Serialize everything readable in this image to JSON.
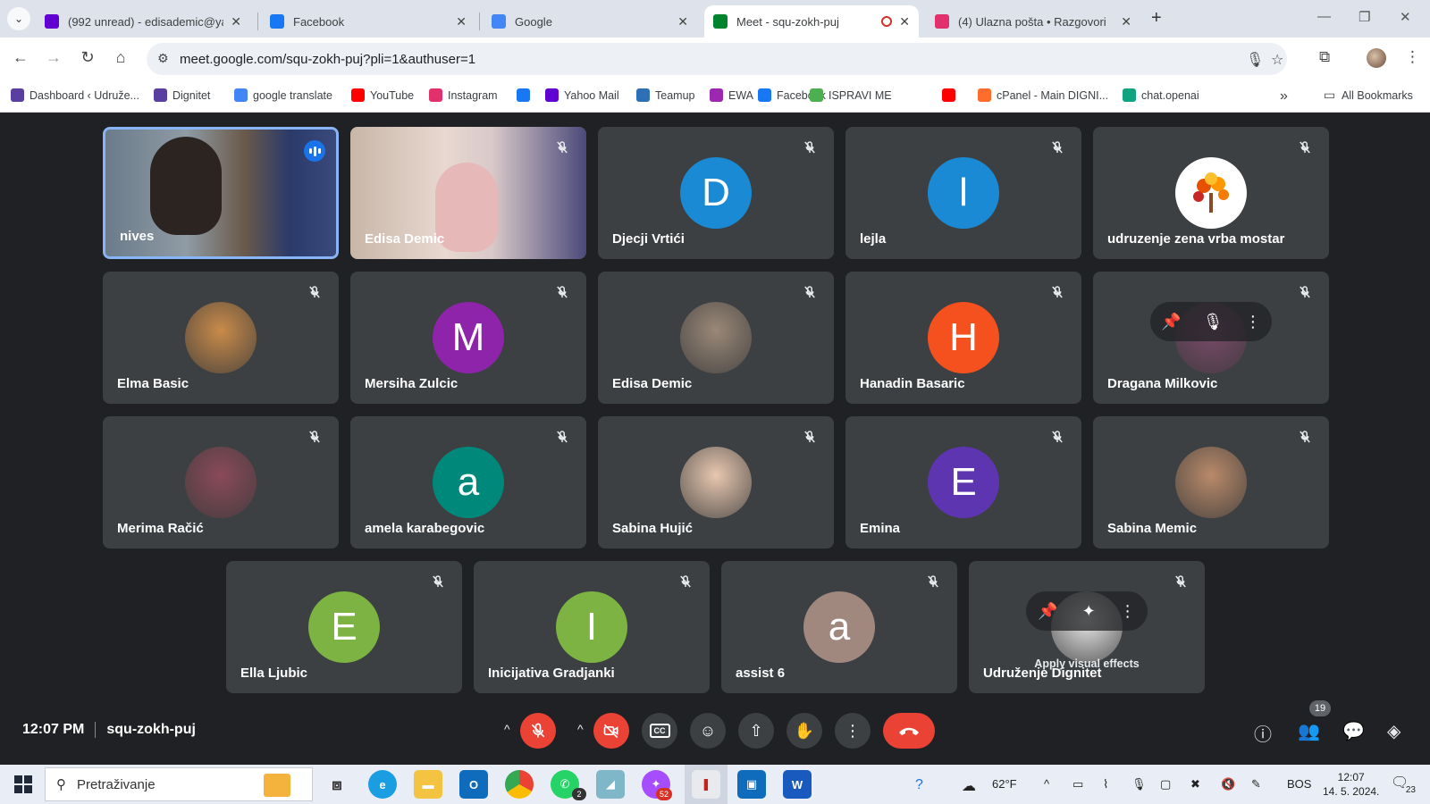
{
  "browser": {
    "tabs": [
      {
        "label": "(992 unread) - edisademic@yah",
        "icon": "yahoo-mail-icon",
        "color": "#6001d2"
      },
      {
        "label": "Facebook",
        "icon": "facebook-icon",
        "color": "#1877f2"
      },
      {
        "label": "Google",
        "icon": "google-icon",
        "color": "#4285f4"
      },
      {
        "label": "Meet - squ-zokh-puj",
        "icon": "meet-icon",
        "color": "#00832d",
        "active": true
      },
      {
        "label": "(4) Ulazna pošta • Razgovori",
        "icon": "instagram-icon",
        "color": "#e1306c"
      }
    ],
    "url": "meet.google.com/squ-zokh-puj?pli=1&authuser=1",
    "bookmarks": [
      {
        "label": "Dashboard ‹ Udruže...",
        "icon": "dashboard-icon",
        "color": "#5b3fa0"
      },
      {
        "label": "Dignitet",
        "icon": "dignitet-icon",
        "color": "#5b3fa0"
      },
      {
        "label": "google translate",
        "icon": "google-icon",
        "color": "#4285f4"
      },
      {
        "label": "YouTube",
        "icon": "youtube-icon",
        "color": "#ff0000"
      },
      {
        "label": "Instagram",
        "icon": "instagram-icon",
        "color": "#e1306c"
      },
      {
        "label": "",
        "icon": "facebook-icon",
        "color": "#1877f2"
      },
      {
        "label": "Yahoo Mail",
        "icon": "yahoo-mail-icon",
        "color": "#6001d2"
      },
      {
        "label": "Teamup",
        "icon": "teamup-icon",
        "color": "#2e6fb7"
      },
      {
        "label": "EWA",
        "icon": "ewa-icon",
        "color": "#9c27b0"
      },
      {
        "label": "Facebook",
        "icon": "facebook-icon",
        "color": "#1877f2"
      },
      {
        "label": "ISPRAVI ME",
        "icon": "check-icon",
        "color": "#4caf50"
      },
      {
        "label": "",
        "icon": "youtube-icon",
        "color": "#ff0000"
      },
      {
        "label": "cPanel - Main DIGNI...",
        "icon": "cpanel-icon",
        "color": "#ff6c2c"
      },
      {
        "label": "chat.openai",
        "icon": "openai-icon",
        "color": "#10a37f"
      }
    ],
    "all_bookmarks": "All Bookmarks"
  },
  "meet": {
    "participants": [
      {
        "name": "nives",
        "type": "video",
        "speaking": true
      },
      {
        "name": "Edisa Demic",
        "type": "video"
      },
      {
        "name": "Djecji Vrtići",
        "type": "letter",
        "letter": "D",
        "color": "#1a8ad4"
      },
      {
        "name": "lejla",
        "type": "letter",
        "letter": "l",
        "color": "#1a8ad4"
      },
      {
        "name": "udruzenje zena vrba mostar",
        "type": "logo"
      },
      {
        "name": "Elma Basic",
        "type": "photo",
        "color": "#c98b4a"
      },
      {
        "name": "Mersiha Zulcic",
        "type": "letter",
        "letter": "M",
        "color": "#8e24aa"
      },
      {
        "name": "Edisa Demic",
        "type": "photo",
        "color": "#9a8878"
      },
      {
        "name": "Hanadin Basaric",
        "type": "letter",
        "letter": "H",
        "color": "#f4511e"
      },
      {
        "name": "Dragana Milkovic",
        "type": "photo-hover",
        "color": "#7a4a6a"
      },
      {
        "name": "Merima Račić",
        "type": "photo",
        "color": "#8a4a5a"
      },
      {
        "name": "amela karabegovic",
        "type": "letter",
        "letter": "a",
        "color": "#00897b"
      },
      {
        "name": "Sabina Hujić",
        "type": "photo",
        "color": "#e8c8b0"
      },
      {
        "name": "Emina",
        "type": "letter",
        "letter": "E",
        "color": "#5e35b1"
      },
      {
        "name": "Sabina Memic",
        "type": "photo",
        "color": "#b98a6a"
      },
      {
        "name": "Ella Ljubic",
        "type": "letter",
        "letter": "E",
        "color": "#7cb342"
      },
      {
        "name": "Inicijativa Gradjanki",
        "type": "letter",
        "letter": "I",
        "color": "#7cb342"
      },
      {
        "name": "assist 6",
        "type": "letter",
        "letter": "a",
        "color": "#a1887f"
      },
      {
        "name": "Udruženje Dignitet",
        "type": "self",
        "color": "#e8e8e8"
      }
    ],
    "self_tooltip": "Apply visual effects",
    "time": "12:07 PM",
    "meeting_code": "squ-zokh-puj",
    "participant_count": "19"
  },
  "taskbar": {
    "search_placeholder": "Pretraživanje",
    "weather": "62°F",
    "language": "BOS",
    "time": "12:07",
    "date": "14. 5. 2024.",
    "whatsapp_badge": "2",
    "messenger_badge": "52",
    "notifications": "23"
  }
}
